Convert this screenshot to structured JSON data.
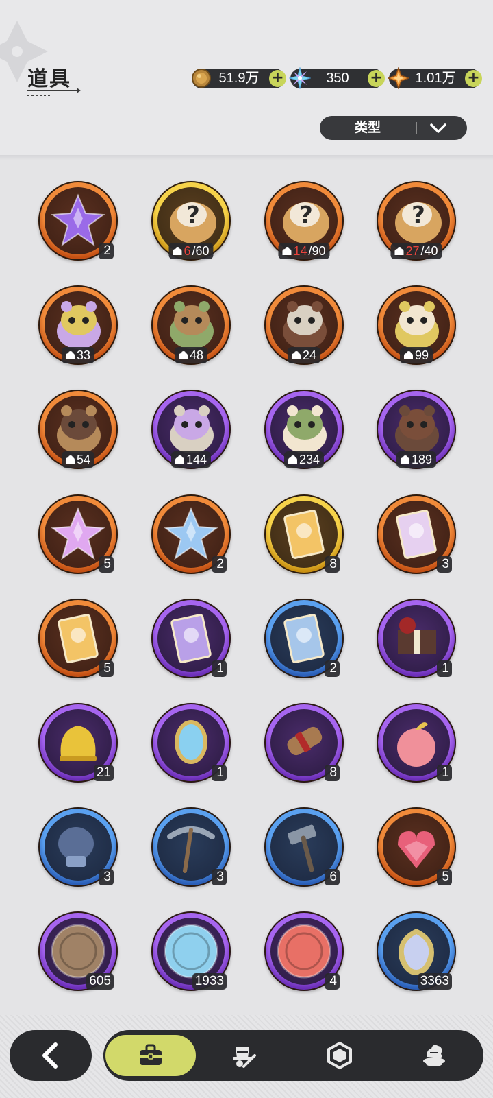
{
  "header": {
    "title": "道具",
    "currencies": [
      {
        "icon": "gold-coin-icon",
        "value": "51.9万",
        "add": "+"
      },
      {
        "icon": "crystal-snowflake-icon",
        "value": "350",
        "add": "+"
      },
      {
        "icon": "orange-star-gem-icon",
        "value": "1.01万",
        "add": "+"
      }
    ]
  },
  "filter": {
    "label": "类型",
    "icon": "chevron-down-icon"
  },
  "items": [
    {
      "name": "purple-crystal-shard-icon",
      "rarity": "orange",
      "count": "2"
    },
    {
      "name": "mystery-plush-icon",
      "rarity": "gold",
      "frag_have": "6",
      "frag_need": "/60",
      "have_red": true
    },
    {
      "name": "mystery-plush-icon",
      "rarity": "orange",
      "frag_have": "14",
      "frag_need": "/90",
      "have_red": true
    },
    {
      "name": "mystery-plush-icon",
      "rarity": "orange",
      "frag_have": "27",
      "frag_need": "/40",
      "have_red": true
    },
    {
      "name": "bear-plush-icon",
      "rarity": "orange",
      "frag_have": "33",
      "frag_need": ""
    },
    {
      "name": "knight-plush-icon",
      "rarity": "orange",
      "frag_have": "48",
      "frag_need": ""
    },
    {
      "name": "white-cat-plush-icon",
      "rarity": "orange",
      "frag_have": "24",
      "frag_need": ""
    },
    {
      "name": "dark-bear-plush-icon",
      "rarity": "orange",
      "frag_have": "99",
      "frag_need": ""
    },
    {
      "name": "unicorn-plush-icon",
      "rarity": "orange",
      "frag_have": "54",
      "frag_need": ""
    },
    {
      "name": "frog-plush-icon",
      "rarity": "purple",
      "frag_have": "144",
      "frag_need": ""
    },
    {
      "name": "pirate-bear-plush-icon",
      "rarity": "purple",
      "frag_have": "234",
      "frag_need": ""
    },
    {
      "name": "yellow-blob-plush-icon",
      "rarity": "purple",
      "frag_have": "189",
      "frag_need": ""
    },
    {
      "name": "pink-star-crystal-icon",
      "rarity": "orange",
      "count": "5"
    },
    {
      "name": "blue-star-crystal-icon",
      "rarity": "orange",
      "count": "2"
    },
    {
      "name": "gold-character-card-icon",
      "rarity": "gold",
      "count": "8"
    },
    {
      "name": "rainbow-character-card-icon",
      "rarity": "orange",
      "count": "3"
    },
    {
      "name": "orange-character-card-icon",
      "rarity": "orange",
      "count": "5"
    },
    {
      "name": "purple-character-card-icon",
      "rarity": "purple",
      "count": "1"
    },
    {
      "name": "blue-character-card-icon",
      "rarity": "blue",
      "count": "2"
    },
    {
      "name": "gift-box-icon",
      "rarity": "purple",
      "count": "1"
    },
    {
      "name": "golden-bell-icon",
      "rarity": "purple",
      "count": "21"
    },
    {
      "name": "magic-mirror-icon",
      "rarity": "purple",
      "count": "1"
    },
    {
      "name": "scroll-icon",
      "rarity": "purple",
      "count": "8"
    },
    {
      "name": "pink-peach-icon",
      "rarity": "purple",
      "count": "1"
    },
    {
      "name": "boxing-glove-icon",
      "rarity": "blue",
      "count": "3"
    },
    {
      "name": "pickaxe-icon",
      "rarity": "blue",
      "count": "3"
    },
    {
      "name": "hammer-icon",
      "rarity": "blue",
      "count": "6"
    },
    {
      "name": "ruby-heart-icon",
      "rarity": "orange",
      "count": "5"
    },
    {
      "name": "fist-medal-icon",
      "rarity": "purple",
      "count": "605"
    },
    {
      "name": "blue-medal-icon",
      "rarity": "purple",
      "count": "1933"
    },
    {
      "name": "heart-medal-icon",
      "rarity": "purple",
      "count": "4"
    },
    {
      "name": "scale-compass-icon",
      "rarity": "blue",
      "count": "3363"
    }
  ],
  "nav": {
    "back": "chevron-left-icon",
    "tabs": [
      {
        "icon": "bag-icon",
        "active": true
      },
      {
        "icon": "hat-wand-icon",
        "active": false
      },
      {
        "icon": "hexagon-gem-icon",
        "active": false
      },
      {
        "icon": "dessert-icon",
        "active": false
      }
    ]
  },
  "colors": {
    "orange": "#e9742a",
    "gold": "#e9b923",
    "purple": "#8b47d6",
    "blue": "#3d7fd8",
    "accent": "#d2d96a",
    "dark": "#2a2b2e"
  }
}
